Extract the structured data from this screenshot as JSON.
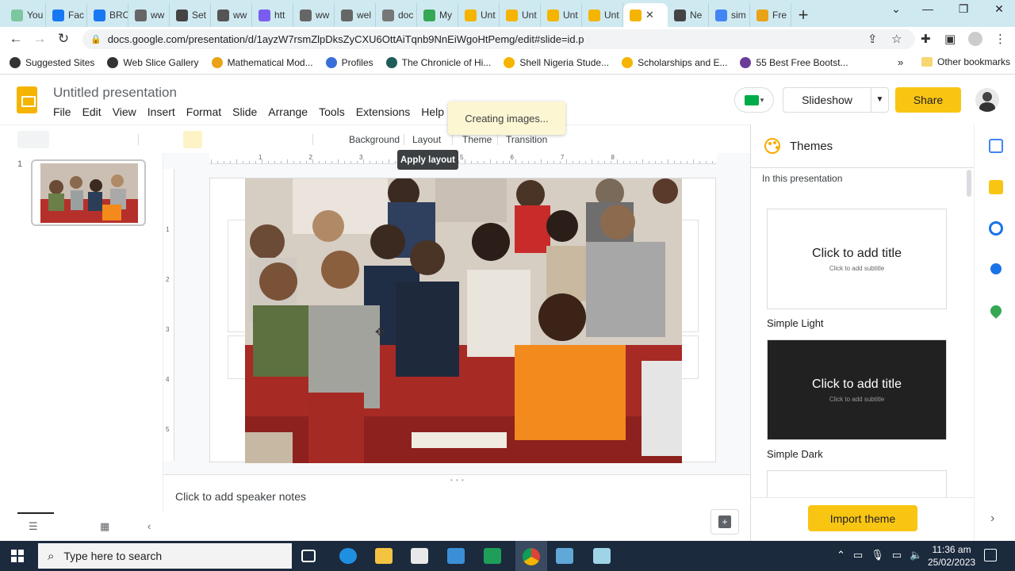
{
  "browser": {
    "tabs": [
      {
        "label": "You",
        "color": "#7cc7a0"
      },
      {
        "label": "Fac",
        "color": "#1877f2"
      },
      {
        "label": "BRC",
        "color": "#1877f2"
      },
      {
        "label": "ww",
        "color": "#666666"
      },
      {
        "label": "Set",
        "color": "#444444"
      },
      {
        "label": "ww",
        "color": "#555555"
      },
      {
        "label": "htt",
        "color": "#7b5cf0"
      },
      {
        "label": "ww",
        "color": "#666666"
      },
      {
        "label": "wel",
        "color": "#666666"
      },
      {
        "label": "doc",
        "color": "#777777"
      },
      {
        "label": "My",
        "color": "#34a853"
      },
      {
        "label": "Unt",
        "color": "#f4b400"
      },
      {
        "label": "Unt",
        "color": "#f4b400"
      },
      {
        "label": "Unt",
        "color": "#f4b400"
      },
      {
        "label": "Unt",
        "color": "#f4b400"
      }
    ],
    "active_tab_color": "#f4b400",
    "tabs_after": [
      {
        "label": "Ne",
        "color": "#444444"
      },
      {
        "label": "sim",
        "color": "#4285f4"
      },
      {
        "label": "Fre",
        "color": "#e8a317"
      }
    ],
    "url": "docs.google.com/presentation/d/1ayzW7rsmZlpDksZyCXU6OttAiTqnb9NnEiWgoHtPemg/edit#slide=id.p",
    "bookmarks": [
      {
        "label": "Suggested Sites",
        "color": "#333333"
      },
      {
        "label": "Web Slice Gallery",
        "color": "#333333"
      },
      {
        "label": "Mathematical Mod...",
        "color": "#e8a317"
      },
      {
        "label": "Profiles",
        "color": "#3a6fd8"
      },
      {
        "label": "The Chronicle of Hi...",
        "color": "#1f5c5c"
      },
      {
        "label": "Shell Nigeria Stude...",
        "color": "#f4b400"
      },
      {
        "label": "Scholarships and E...",
        "color": "#f4b400"
      },
      {
        "label": "55 Best Free Bootst...",
        "color": "#6a3d9a"
      }
    ],
    "more_bookmarks": "»",
    "other_bookmarks": "Other bookmarks"
  },
  "app": {
    "title": "Untitled presentation",
    "menu": [
      "File",
      "Edit",
      "View",
      "Insert",
      "Format",
      "Slide",
      "Arrange",
      "Tools",
      "Extensions",
      "Help"
    ],
    "toast": "Creating images...",
    "slideshow_label": "Slideshow",
    "share_label": "Share",
    "accent": "#f9c513"
  },
  "toolbar": {
    "background": "Background",
    "layout": "Layout",
    "theme": "Theme",
    "transition": "Transition",
    "tooltip": "Apply layout"
  },
  "filmstrip": {
    "slide_number": "1"
  },
  "ruler": {
    "h": [
      "1",
      "2",
      "3",
      "4",
      "5",
      "6",
      "7",
      "8"
    ],
    "v": [
      "1",
      "2",
      "3",
      "4",
      "5"
    ]
  },
  "notes": {
    "placeholder": "Click to add speaker notes"
  },
  "themes": {
    "title": "Themes",
    "section": "In this presentation",
    "cards": [
      {
        "name": "Simple Light",
        "title": "Click to add title",
        "subtitle": "Click to add subtitle",
        "bg": "#ffffff",
        "fg": "#202124"
      },
      {
        "name": "Simple Dark",
        "title": "Click to add title",
        "subtitle": "Click to add subtitle",
        "bg": "#212121",
        "fg": "#ffffff"
      }
    ],
    "import_label": "Import theme"
  },
  "taskbar": {
    "search_placeholder": "Type here to search",
    "time": "11:36 am",
    "date": "25/02/2023"
  }
}
